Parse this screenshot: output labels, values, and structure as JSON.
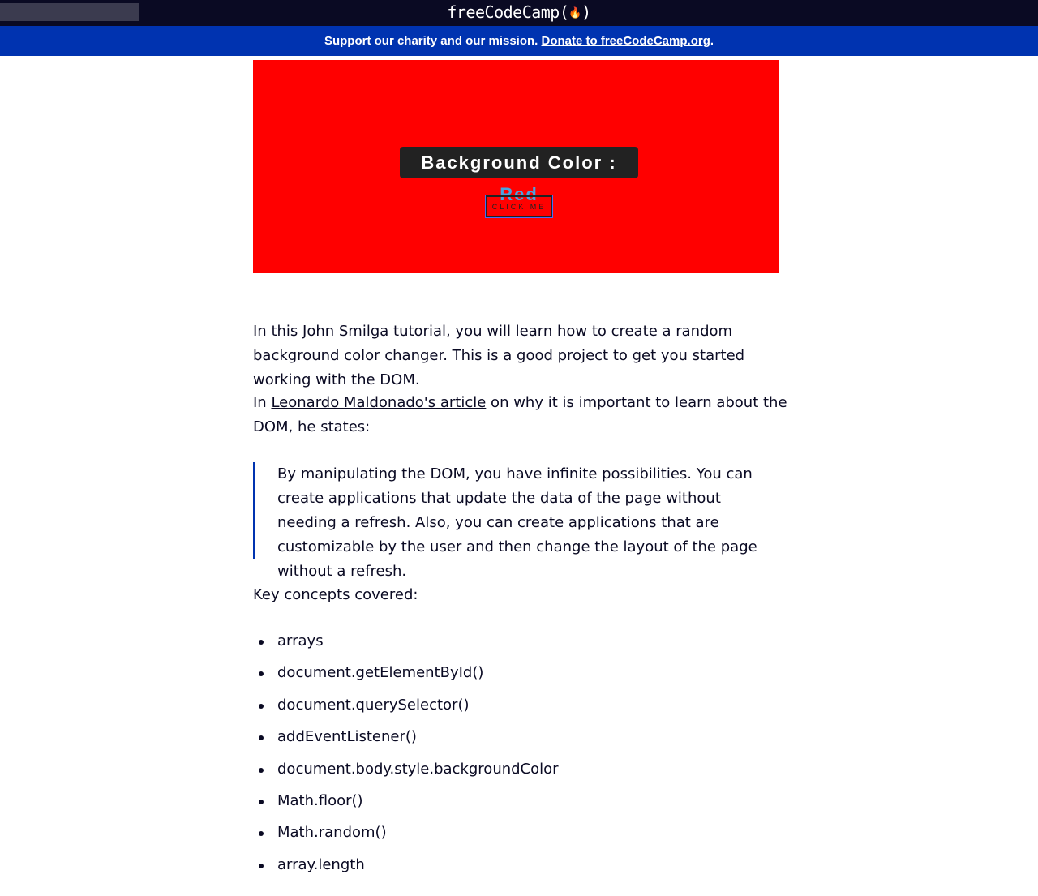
{
  "topbar": {
    "brand_text": "freeCodeCamp(",
    "brand_flame": "🔥",
    "brand_close": ")"
  },
  "donate_bar": {
    "text": "Support our charity and our mission. ",
    "link": "Donate to freeCodeCamp.org",
    "suffix": "."
  },
  "hero": {
    "background": "#ff0000",
    "label_prefix": "Background Color : ",
    "label_value": "Red",
    "button_label": "CLICK ME"
  },
  "article": {
    "p1_pre": "In this ",
    "p1_link": "John Smilga tutorial",
    "p1_post": ", you will learn how to create a random background color changer. This is a good project to get you started working with the DOM.",
    "p2_pre": "In ",
    "p2_link": "Leonardo Maldonado's article",
    "p2_post": " on why it is important to learn about the DOM, he states:",
    "quote": "By manipulating the DOM, you have infinite possibilities. You can create applications that update the data of the page without needing a refresh. Also, you can create applications that are customizable by the user and then change the layout of the page without a refresh.",
    "concepts_heading": "Key concepts covered:",
    "concepts": [
      "arrays",
      "document.getElementById()",
      "document.querySelector()",
      "addEventListener()",
      "document.body.style.backgroundColor",
      "Math.floor()",
      "Math.random()",
      "array.length"
    ]
  },
  "colors": {
    "nav_bg": "#0a0a23",
    "donate_bg": "#0033b0",
    "accent_blue": "#4aa3df"
  }
}
